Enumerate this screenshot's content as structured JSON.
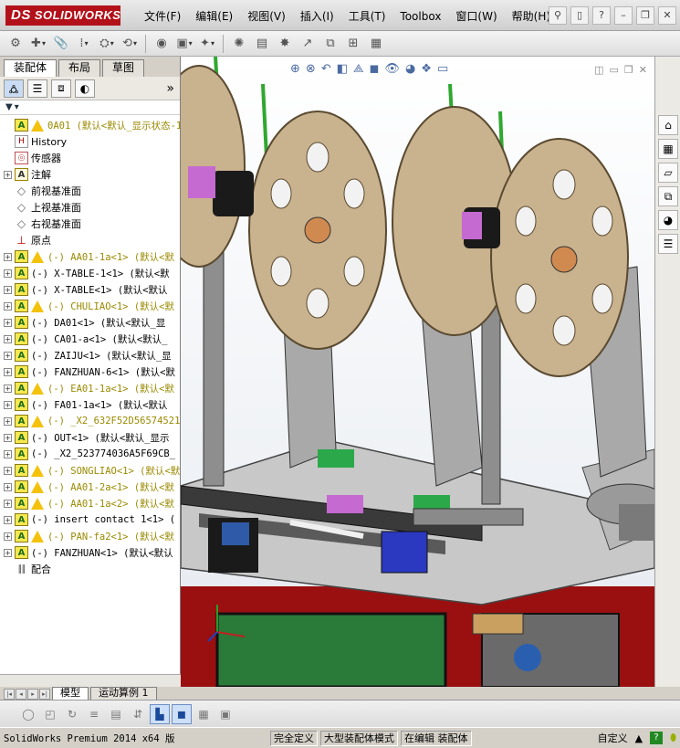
{
  "app": {
    "logo_prefix": "DS",
    "logo_text": "SOLIDWORKS"
  },
  "menu": [
    "文件(F)",
    "编辑(E)",
    "视图(V)",
    "插入(I)",
    "工具(T)",
    "Toolbox",
    "窗口(W)",
    "帮助(H)"
  ],
  "titlebar_icons": [
    "pin-icon",
    "new-doc-icon",
    "help-query-icon",
    "minimize-icon",
    "restore-icon",
    "close-icon"
  ],
  "panel": {
    "tabs": [
      "装配体",
      "布局",
      "草图"
    ],
    "more_glyph": "»"
  },
  "tree": {
    "root": "0A01  (默认<默认_显示状态-1>)",
    "items": [
      {
        "label": "History",
        "type": "hist",
        "expand": false
      },
      {
        "label": "传感器",
        "type": "sens",
        "expand": false
      },
      {
        "label": "注解",
        "type": "ann",
        "expand": true
      },
      {
        "label": "前视基准面",
        "type": "plane",
        "expand": false
      },
      {
        "label": "上视基准面",
        "type": "plane",
        "expand": false
      },
      {
        "label": "右视基准面",
        "type": "plane",
        "expand": false
      },
      {
        "label": "原点",
        "type": "origin",
        "expand": false
      },
      {
        "label": "(-) AA01-1a<1> (默认<默",
        "type": "comp",
        "warn": true
      },
      {
        "label": "(-) X-TABLE-1<1> (默认<默",
        "type": "comp",
        "warn": false
      },
      {
        "label": "(-) X-TABLE<1> (默认<默认",
        "type": "comp",
        "warn": false
      },
      {
        "label": "(-) CHULIAO<1> (默认<默",
        "type": "comp",
        "warn": true
      },
      {
        "label": "(-) DA01<1> (默认<默认_显",
        "type": "comp",
        "warn": false
      },
      {
        "label": "(-) CA01-a<1> (默认<默认_",
        "type": "comp",
        "warn": false
      },
      {
        "label": "(-) ZAIJU<1> (默认<默认_显",
        "type": "comp",
        "warn": false
      },
      {
        "label": "(-) FANZHUAN-6<1> (默认<默",
        "type": "comp",
        "warn": false
      },
      {
        "label": "(-) EA01-1a<1> (默认<默",
        "type": "comp",
        "warn": true
      },
      {
        "label": "(-) FA01-1a<1> (默认<默认",
        "type": "comp",
        "warn": false
      },
      {
        "label": "(-) _X2_632F52D56574521",
        "type": "comp",
        "warn": true
      },
      {
        "label": "(-) OUT<1> (默认<默认_显示",
        "type": "comp",
        "warn": false
      },
      {
        "label": "(-) _X2_523774036A5F69CB_",
        "type": "comp",
        "warn": false
      },
      {
        "label": "(-) SONGLIAO<1> (默认<默",
        "type": "comp",
        "warn": true
      },
      {
        "label": "(-) AA01-2a<1> (默认<默",
        "type": "comp",
        "warn": true
      },
      {
        "label": "(-) AA01-1a<2> (默认<默",
        "type": "comp",
        "warn": true
      },
      {
        "label": "(-) insert contact 1<1> (",
        "type": "comp",
        "warn": false
      },
      {
        "label": "(-) PAN-fa2<1> (默认<默",
        "type": "comp",
        "warn": true
      },
      {
        "label": "(-) FANZHUAN<1> (默认<默认",
        "type": "comp",
        "warn": false
      },
      {
        "label": "配合",
        "type": "mate",
        "expand": false
      }
    ]
  },
  "bottom_tabs": [
    "模型",
    "运动算例 1"
  ],
  "status": {
    "product": "SolidWorks Premium 2014 x64 版",
    "cells": [
      "完全定义",
      "大型装配体模式",
      "在编辑 装配体"
    ],
    "custom": "自定义",
    "caret": "▲",
    "help": "?"
  },
  "colors": {
    "brand_red": "#b3111a",
    "warning_yellow": "#f4c20d",
    "plate_tan": "#c9b28e",
    "frame_green": "#2e8b3a",
    "base_red": "#a01010"
  }
}
